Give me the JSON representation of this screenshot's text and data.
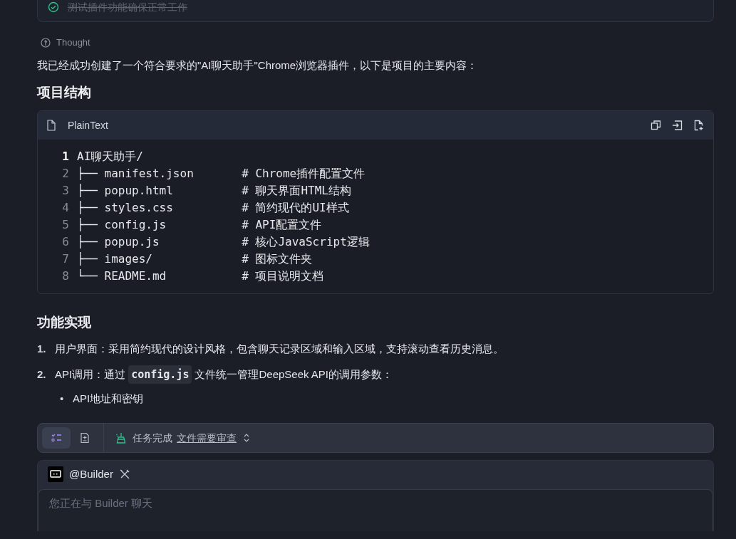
{
  "task_card": {
    "items": [
      {
        "text": "测试插件功能确保正常工作",
        "done": true
      }
    ]
  },
  "thought": {
    "label": "Thought"
  },
  "intro": "我已经成功创建了一个符合要求的\"AI聊天助手\"Chrome浏览器插件，以下是项目的主要内容：",
  "section_1": {
    "heading": "项目结构"
  },
  "code_block": {
    "language": "PlainText",
    "lines": [
      {
        "number": "1",
        "text": "AI聊天助手/",
        "selected": true
      },
      {
        "number": "2",
        "text": "├── manifest.json       # Chrome插件配置文件",
        "selected": false
      },
      {
        "number": "3",
        "text": "├── popup.html          # 聊天界面HTML结构",
        "selected": false
      },
      {
        "number": "4",
        "text": "├── styles.css          # 简约现代的UI样式",
        "selected": false
      },
      {
        "number": "5",
        "text": "├── config.js           # API配置文件",
        "selected": false
      },
      {
        "number": "6",
        "text": "├── popup.js            # 核心JavaScript逻辑",
        "selected": false
      },
      {
        "number": "7",
        "text": "├── images/             # 图标文件夹",
        "selected": false
      },
      {
        "number": "8",
        "text": "└── README.md           # 项目说明文档",
        "selected": false
      }
    ]
  },
  "section_2": {
    "heading": "功能实现",
    "list": [
      {
        "marker": "1.",
        "parts": [
          {
            "kind": "text",
            "text": "用户界面：采用简约现代的设计风格，包含聊天记录区域和输入区域，支持滚动查看历史消息。"
          }
        ]
      },
      {
        "marker": "2.",
        "parts": [
          {
            "kind": "text",
            "text": "API调用：通过"
          },
          {
            "kind": "code",
            "text": "config.js"
          },
          {
            "kind": "text",
            "text": "文件统一管理DeepSeek API的调用参数："
          }
        ],
        "children": [
          {
            "marker": "•",
            "text": "API地址和密钥"
          }
        ]
      }
    ]
  },
  "status_bar": {
    "tabs": [
      {
        "selected": true
      },
      {
        "selected": false
      }
    ],
    "status": "任务完成",
    "link": "文件需要审查"
  },
  "chat": {
    "agent": "@Builder",
    "placeholder": "您正在与 Builder 聊天"
  }
}
